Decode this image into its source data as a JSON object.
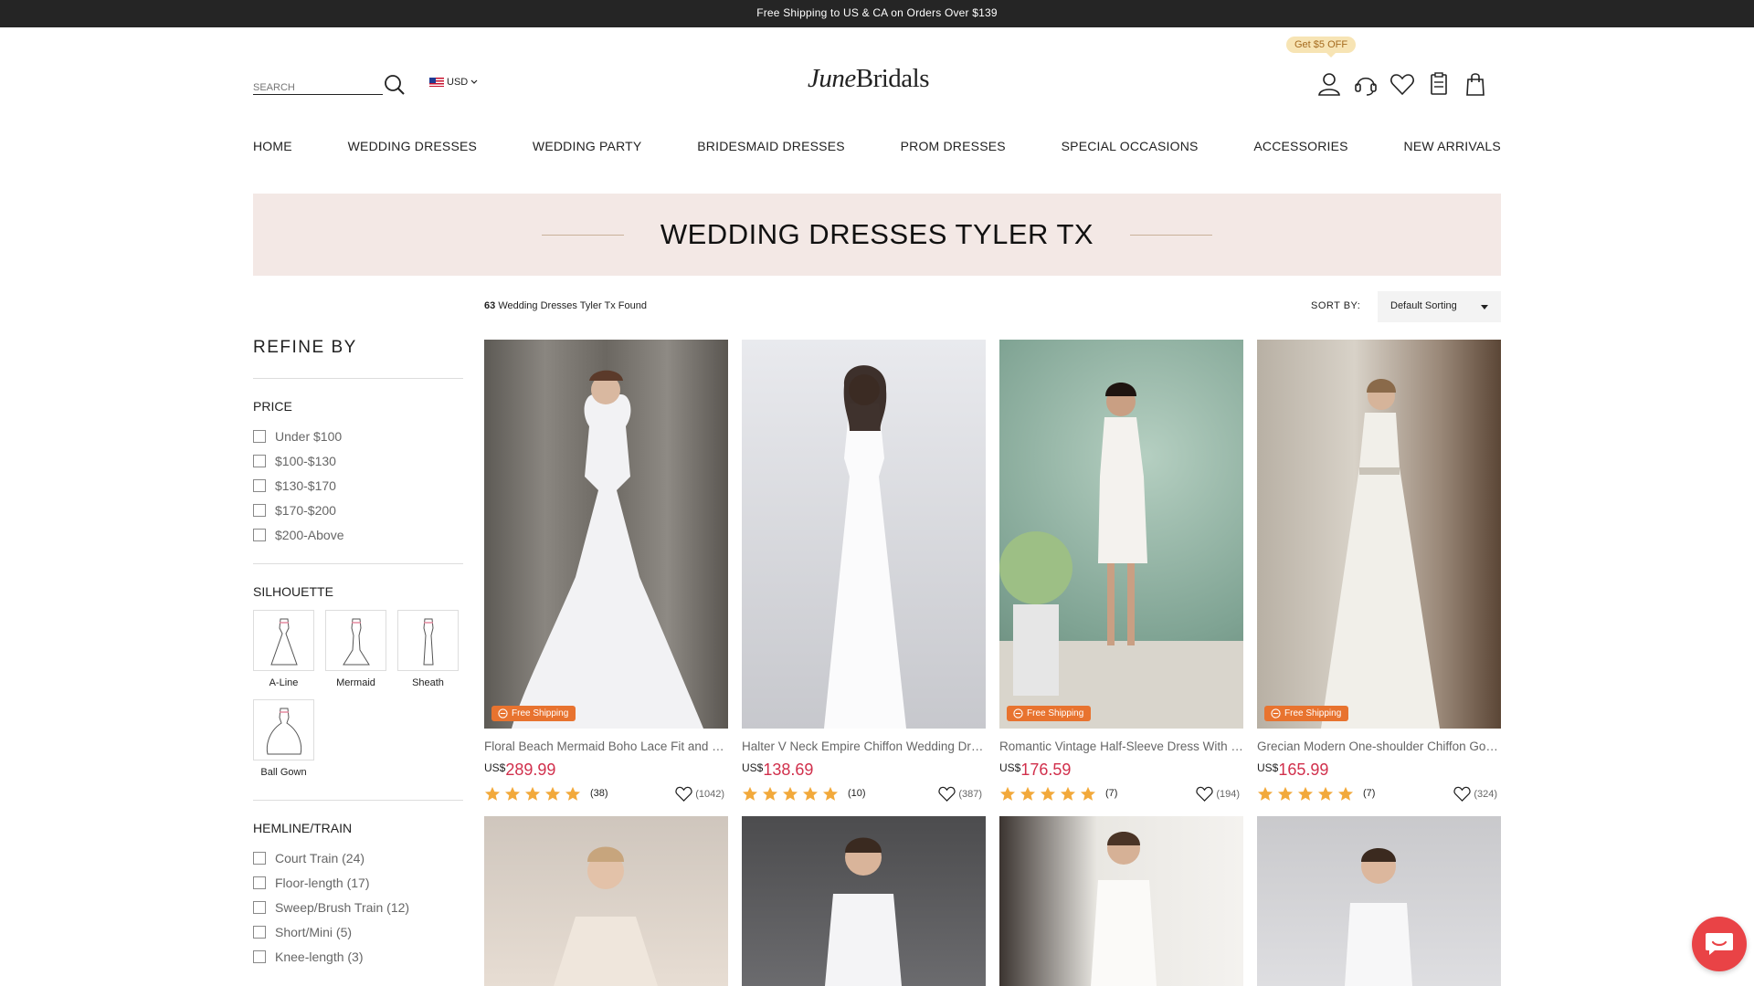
{
  "topbar": {
    "text": "Free Shipping to US & CA on Orders Over $139"
  },
  "header": {
    "search_placeholder": "SEARCH",
    "currency": "USD",
    "logo_june": "June",
    "logo_bridals": "Bridals",
    "promo": "Get $5 OFF",
    "icons": [
      "account-icon",
      "support-icon",
      "wishlist-icon",
      "orders-icon",
      "cart-icon"
    ]
  },
  "nav": [
    "HOME",
    "WEDDING DRESSES",
    "WEDDING PARTY",
    "BRIDESMAID DRESSES",
    "PROM DRESSES",
    "SPECIAL OCCASIONS",
    "ACCESSORIES",
    "NEW ARRIVALS"
  ],
  "banner": {
    "title": "WEDDING DRESSES TYLER TX"
  },
  "results": {
    "count": "63",
    "text": "Wedding Dresses Tyler Tx Found"
  },
  "sort": {
    "label": "SORT BY:",
    "value": "Default Sorting"
  },
  "sidebar": {
    "title": "REFINE BY",
    "price": {
      "title": "PRICE",
      "options": [
        "Under $100",
        "$100-$130",
        "$130-$170",
        "$170-$200",
        "$200-Above"
      ]
    },
    "silhouette": {
      "title": "SILHOUETTE",
      "options": [
        "A-Line",
        "Mermaid",
        "Sheath",
        "Ball Gown"
      ]
    },
    "hemline": {
      "title": "HEMLINE/TRAIN",
      "options": [
        "Court Train (24)",
        "Floor-length (17)",
        "Sweep/Brush Train (12)",
        "Short/Mini (5)",
        "Knee-length (3)"
      ]
    }
  },
  "products": [
    {
      "title": "Floral Beach Mermaid Boho Lace Fit and Flare Wedding Dress",
      "currency": "US$",
      "price": "289.99",
      "reviews": "(38)",
      "favs": "(1042)",
      "free_shipping": "Free Shipping",
      "rating": 5
    },
    {
      "title": "Halter V Neck Empire Chiffon Wedding Dress",
      "currency": "US$",
      "price": "138.69",
      "reviews": "(10)",
      "favs": "(387)",
      "free_shipping": "",
      "rating": 5
    },
    {
      "title": "Romantic Vintage Half-Sleeve Dress With Lace",
      "currency": "US$",
      "price": "176.59",
      "reviews": "(7)",
      "favs": "(194)",
      "free_shipping": "Free Shipping",
      "rating": 5
    },
    {
      "title": "Grecian Modern One-shoulder Chiffon Gown",
      "currency": "US$",
      "price": "165.99",
      "reviews": "(7)",
      "favs": "(324)",
      "free_shipping": "Free Shipping",
      "rating": 5
    }
  ],
  "colors": {
    "accent_price": "#d1304c",
    "ship_badge": "#e8732f",
    "banner_bg": "#f3e8e5",
    "chat": "#e94346",
    "star": "#f2a93b"
  }
}
